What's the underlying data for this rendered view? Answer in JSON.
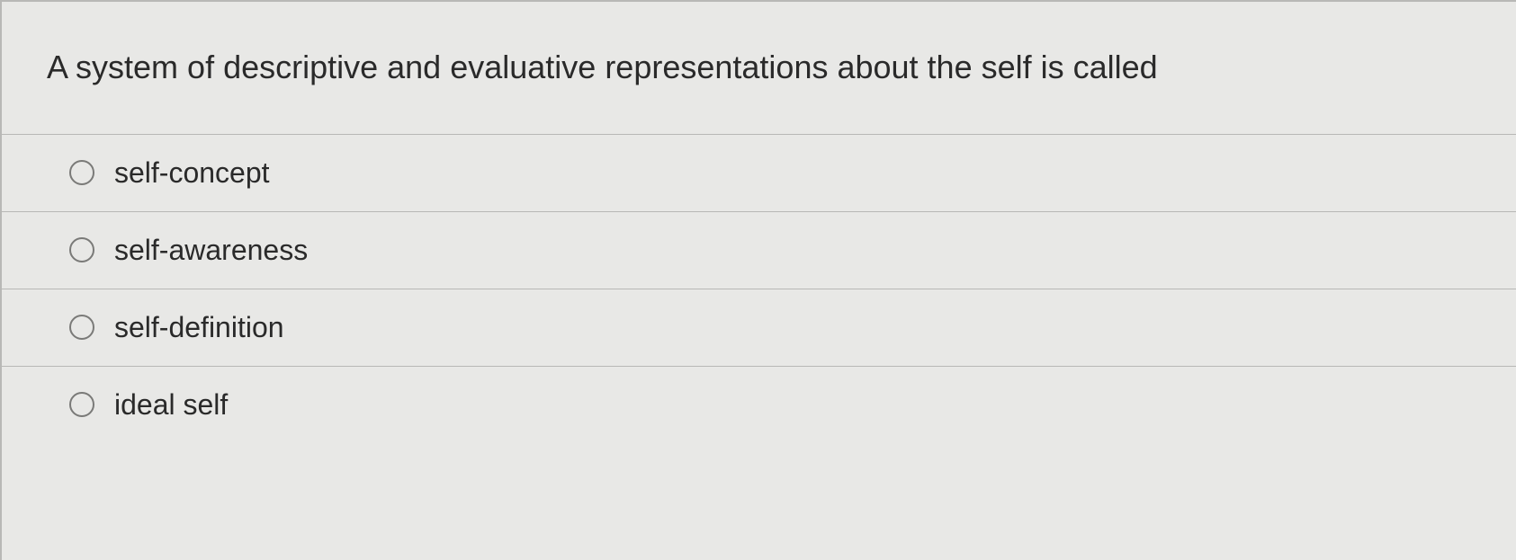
{
  "question": {
    "text": "A system of descriptive and evaluative representations about the self is called"
  },
  "options": [
    {
      "label": "self-concept"
    },
    {
      "label": "self-awareness"
    },
    {
      "label": "self-definition"
    },
    {
      "label": "ideal self"
    }
  ]
}
